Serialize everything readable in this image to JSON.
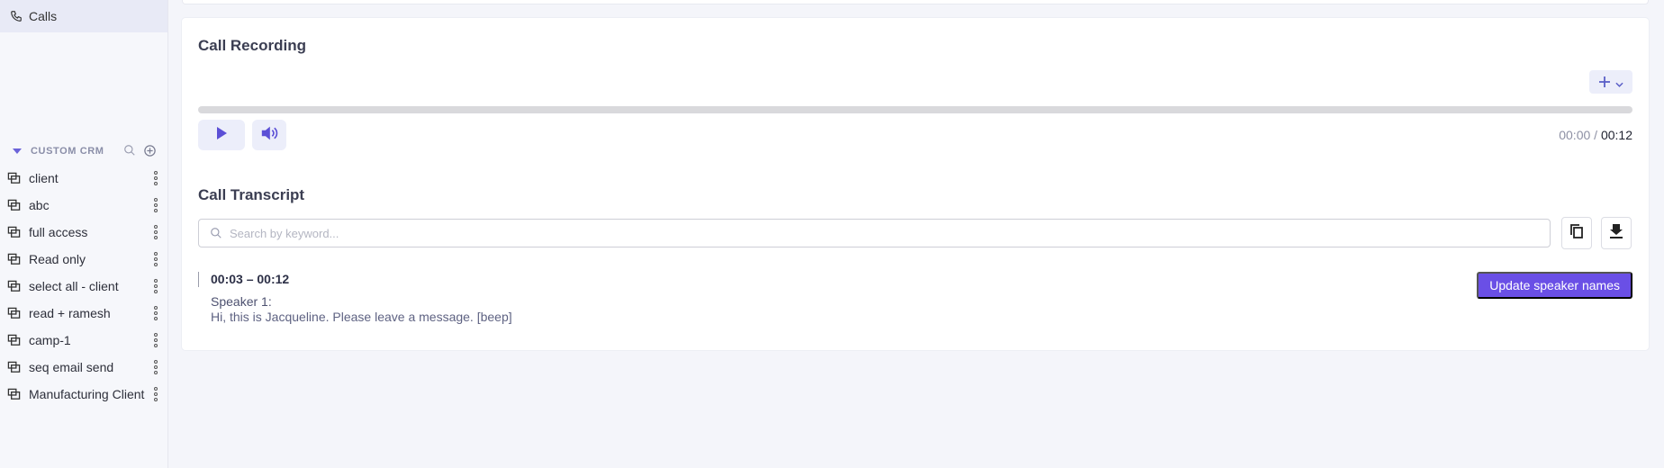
{
  "sidebar": {
    "calls_label": "Calls",
    "crm_header": "CUSTOM CRM",
    "items": [
      {
        "label": "client"
      },
      {
        "label": "abc"
      },
      {
        "label": "full access"
      },
      {
        "label": "Read only"
      },
      {
        "label": "select all - client"
      },
      {
        "label": "read + ramesh"
      },
      {
        "label": "camp-1"
      },
      {
        "label": "seq email send"
      },
      {
        "label": "Manufacturing Client"
      }
    ]
  },
  "recording": {
    "title": "Call Recording",
    "add_icon": "plus-icon",
    "progress": 0,
    "current_time": "00:00",
    "separator": " / ",
    "duration": "00:12"
  },
  "transcript": {
    "title": "Call Transcript",
    "search_placeholder": "Search by keyword...",
    "update_button": "Update speaker names",
    "segments": [
      {
        "range": "00:03 – 00:12",
        "speaker": "Speaker 1:",
        "text": "Hi, this is Jacqueline. Please leave a message. [beep]"
      }
    ]
  },
  "colors": {
    "accent": "#6a4fe6",
    "icon_accent": "#5b5fc7",
    "active_nav_bg": "#e8eaf6"
  }
}
